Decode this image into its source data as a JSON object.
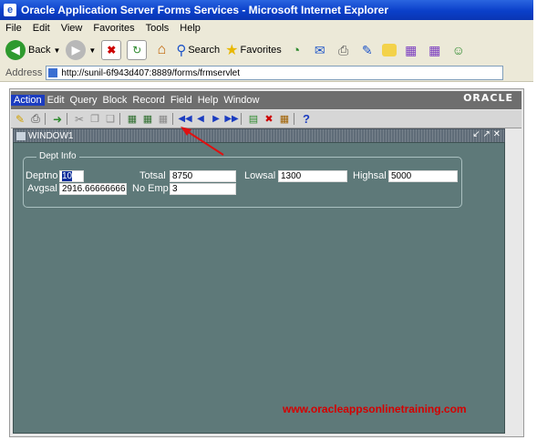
{
  "ie": {
    "title": "Oracle Application Server Forms Services - Microsoft Internet Explorer",
    "menu": [
      "File",
      "Edit",
      "View",
      "Favorites",
      "Tools",
      "Help"
    ],
    "toolbar": {
      "back": "Back",
      "search": "Search",
      "favorites": "Favorites"
    },
    "address_label": "Address",
    "address_url": "http://sunil-6f943d407:8889/forms/frmservlet"
  },
  "forms": {
    "menu": [
      "Action",
      "Edit",
      "Query",
      "Block",
      "Record",
      "Field",
      "Help",
      "Window"
    ],
    "active_menu": "Action",
    "logo": "ORACLE",
    "window_title": "WINDOW1",
    "frame_title": "Dept Info",
    "fields": {
      "deptno_label": "Deptno",
      "deptno_value": "10",
      "totsal_label": "Totsal",
      "totsal_value": "8750",
      "lowsal_label": "Lowsal",
      "lowsal_value": "1300",
      "highsal_label": "Highsal",
      "highsal_value": "5000",
      "avgsal_label": "Avgsal",
      "avgsal_value": "2916.666666666",
      "noemp_label": "No Emp",
      "noemp_value": "3"
    }
  },
  "watermark": "www.oracleappsonlinetraining.com",
  "colors": {
    "forms_bg": "#5e7979",
    "arrow": "#e01010",
    "watermark": "#d40000"
  }
}
